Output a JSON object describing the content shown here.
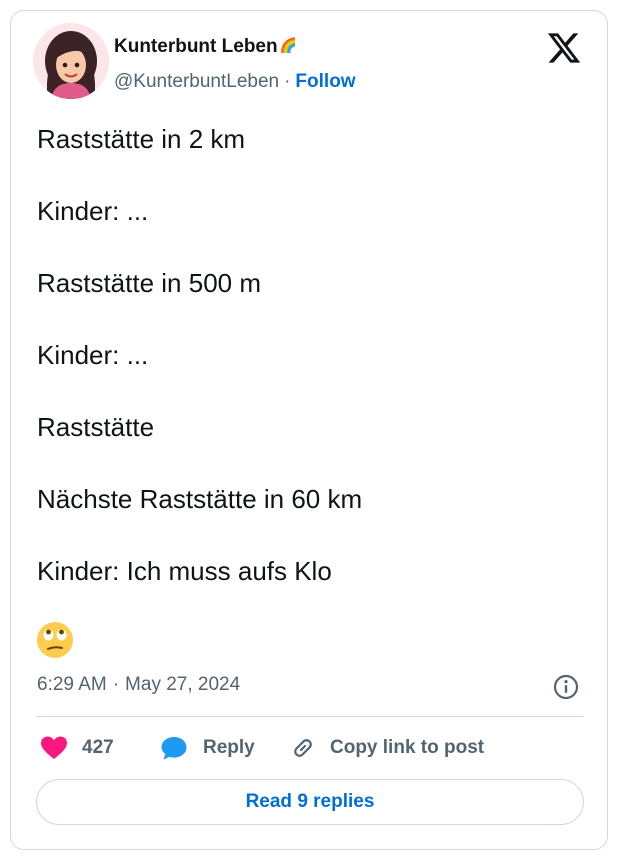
{
  "author": {
    "name": "Kunterbunt Leben",
    "name_badge": "🌈",
    "handle": "@KunterbuntLeben",
    "separator": "·",
    "follow_label": "Follow",
    "avatar_icon": "avatar-cartoon-woman"
  },
  "platform_logo": "x-logo",
  "tweet": {
    "lines": [
      "Raststätte in 2 km",
      "Kinder: ...",
      "Raststätte in 500 m",
      "Kinder: ...",
      "Raststätte",
      "Nächste Raststätte in 60 km",
      "Kinder: Ich muss aufs Klo"
    ],
    "emoji": "face-with-rolling-eyes"
  },
  "meta": {
    "time": "6:29 AM",
    "separator": "·",
    "date": "May 27, 2024",
    "info_icon": "info-icon"
  },
  "actions": {
    "like_count": "427",
    "reply_label": "Reply",
    "copy_link_label": "Copy link to post"
  },
  "read_replies_label": "Read 9 replies",
  "colors": {
    "accent": "#006fd6",
    "like": "#f91880",
    "reply_bubble": "#1d9bf0",
    "muted_text": "#536471",
    "border": "#cfd9de"
  }
}
